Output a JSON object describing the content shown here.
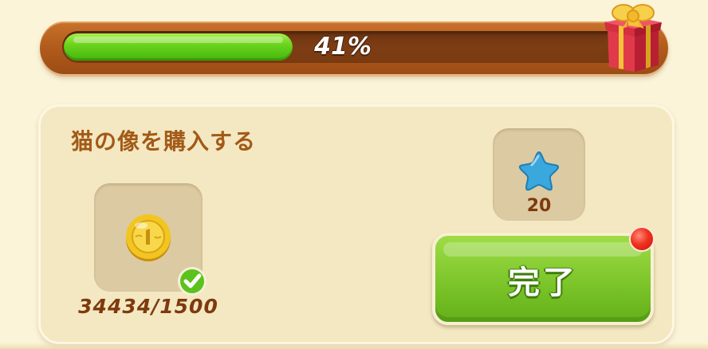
{
  "progress": {
    "percent_label": "41%",
    "fraction": 0.41
  },
  "reward": {
    "icon": "gift-box-icon"
  },
  "quest": {
    "title": "猫の像を購入する",
    "requirement": {
      "icon": "gold-coin-icon",
      "progress_text": "34434/1500",
      "completed": true
    },
    "reward_item": {
      "icon": "blue-star-icon",
      "amount": "20"
    },
    "done_button": {
      "label": "完了",
      "has_notification": true
    }
  },
  "colors": {
    "progress_fill": "#6cd41e",
    "frame": "#b35d1d",
    "button": "#7cc52a",
    "title_text": "#a25a17",
    "notification": "#f0331f"
  }
}
